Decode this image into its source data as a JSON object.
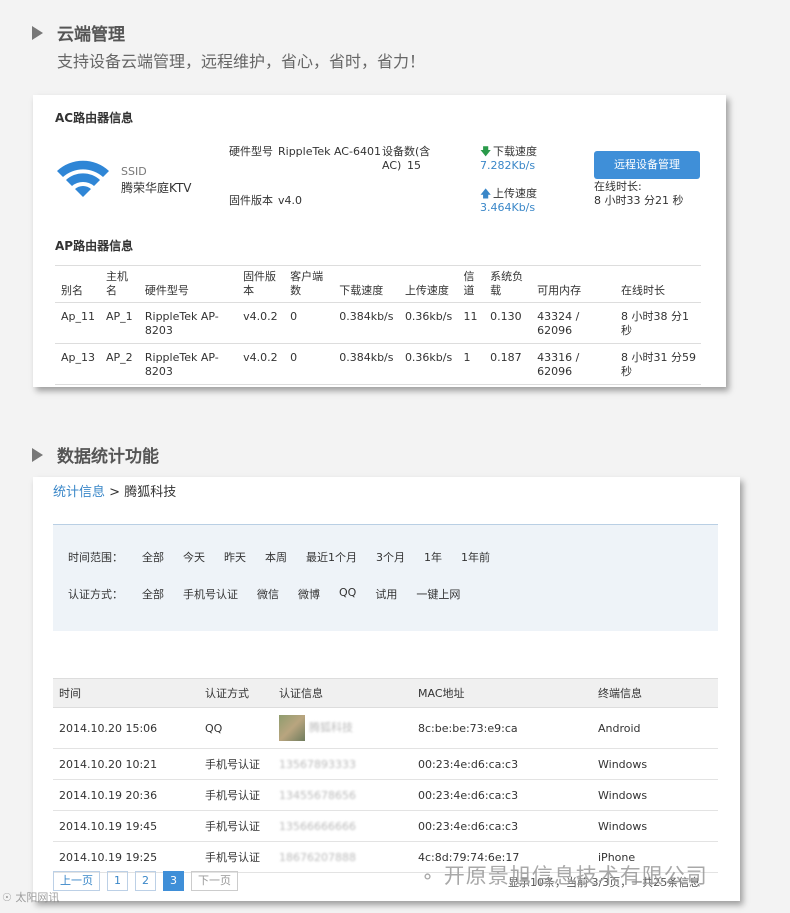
{
  "section1": {
    "title": "云端管理",
    "subtitle": "支持设备云端管理，远程维护，省心，省时，省力！"
  },
  "ac": {
    "header": "AC路由器信息",
    "ssid_label": "SSID",
    "ssid_value": "腾荣华庭KTV",
    "hw_label": "硬件型号",
    "hw_value": "RippleTek AC-6401",
    "fw_label": "固件版本",
    "fw_value": "v4.0",
    "devices_label": "设备数(含AC)",
    "devices_value": "15",
    "down_label": "下载速度",
    "down_value": "7.282Kb/s",
    "up_label": "上传速度",
    "up_value": "3.464Kb/s",
    "remote_button": "远程设备管理",
    "online_label": "在线时长:",
    "online_value": "8 小时33 分21 秒",
    "colors": {
      "accent": "#3f8fd8",
      "wifi": "#2f86d6"
    }
  },
  "ap": {
    "header": "AP路由器信息",
    "columns": [
      "别名",
      "主机名",
      "硬件型号",
      "固件版本",
      "客户端数",
      "下载速度",
      "上传速度",
      "信道",
      "系统负载",
      "可用内存",
      "在线时长"
    ],
    "rows": [
      [
        "Ap_11",
        "AP_1",
        "RippleTek AP-8203",
        "v4.0.2",
        "0",
        "0.384kb/s",
        "0.36kb/s",
        "11",
        "0.130",
        "43324 / 62096",
        "8 小时38 分1 秒"
      ],
      [
        "Ap_13",
        "AP_2",
        "RippleTek AP-8203",
        "v4.0.2",
        "0",
        "0.384kb/s",
        "0.36kb/s",
        "1",
        "0.187",
        "43316 / 62096",
        "8 小时31 分59 秒"
      ]
    ]
  },
  "section2": {
    "title": "数据统计功能"
  },
  "stats": {
    "crumb_link": "统计信息",
    "crumb_sep": " > ",
    "crumb_current": "腾狐科技",
    "time_label": "时间范围：",
    "time_options": [
      "全部",
      "今天",
      "昨天",
      "本周",
      "最近1个月",
      "3个月",
      "1年",
      "1年前"
    ],
    "auth_label": "认证方式：",
    "auth_options": [
      "全部",
      "手机号认证",
      "微信",
      "微博",
      "QQ",
      "试用",
      "一键上网"
    ],
    "columns": [
      "时间",
      "认证方式",
      "认证信息",
      "MAC地址",
      "终端信息"
    ],
    "rows": [
      [
        "2014.10.20 15:06",
        "QQ",
        "腾狐科技",
        "8c:be:be:73:e9:ca",
        "Android"
      ],
      [
        "2014.10.20 10:21",
        "手机号认证",
        "13567893333",
        "00:23:4e:d6:ca:c3",
        "Windows"
      ],
      [
        "2014.10.19 20:36",
        "手机号认证",
        "13455678656",
        "00:23:4e:d6:ca:c3",
        "Windows"
      ],
      [
        "2014.10.19 19:45",
        "手机号认证",
        "13566666666",
        "00:23:4e:d6:ca:c3",
        "Windows"
      ],
      [
        "2014.10.19 19:25",
        "手机号认证",
        "18676207888",
        "4c:8d:79:74:6e:17",
        "iPhone"
      ]
    ],
    "pager": {
      "prev": "上一页",
      "pages": [
        "1",
        "2",
        "3"
      ],
      "current": "3",
      "next": "下一页",
      "info": "显示10条，当前 3/3页，一共25条信息"
    }
  },
  "watermark": {
    "main": "开原景旭信息技术有限公司",
    "corner": "太阳网讯"
  }
}
